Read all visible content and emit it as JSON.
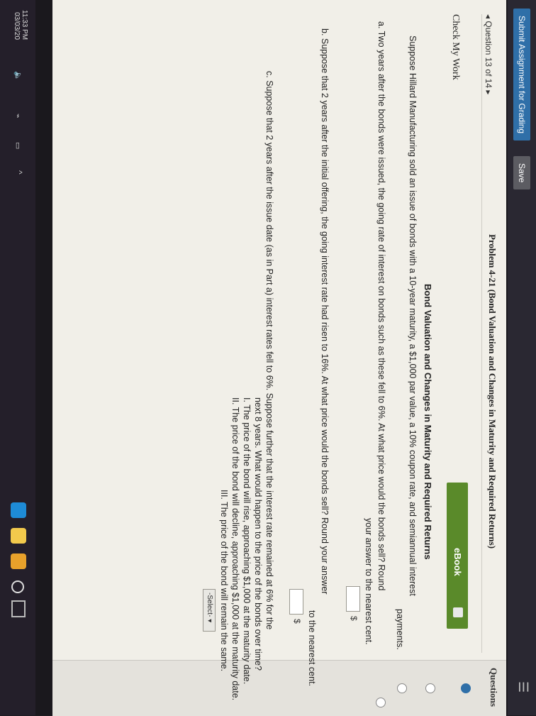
{
  "header": {
    "submit_label": "Submit Assignment for Grading",
    "save_label": "Save"
  },
  "sidebar": {
    "title": "Questions"
  },
  "question_nav": {
    "label": "◂ Question 13 of 14 ▸"
  },
  "problem": {
    "title": "Problem 4-21 (Bond Valuation and Changes in Maturity and Required Returns)",
    "check_label": "Check My Work",
    "ebook_label": "eBook",
    "heading": "Bond Valuation and Changes in Maturity and Required Returns",
    "intro1": "Suppose Hillard Manufacturing sold an issue of bonds with a 10-year maturity, a $1,000 par value, a 10% coupon rate, and semiannual interest",
    "intro2": "payments.",
    "a1": "a. Two years after the bonds were issued, the going rate of interest on bonds such as these fell to 6%. At what price would the bonds sell? Round",
    "a2": "your answer to the nearest cent.",
    "dollar": "$",
    "b1": "b. Suppose that 2 years after the initial offering, the going interest rate had risen to 16%. At what price would the bonds sell? Round your answer",
    "b2": "to the nearest cent.",
    "c1": "c. Suppose that 2 years after the issue date (as in Part a) interest rates fell to 6%. Suppose further that the interest rate remained at 6% for the",
    "c2": "next 8 years. What would happen to the price of the bonds over time?",
    "opt1": "I. The price of the bond will rise, approaching $1,000 at the maturity date.",
    "opt2": "II. The price of the bond will decline, approaching $1,000 at the maturity date.",
    "opt3": "III. The price of the bond will remain the same.",
    "select_label": "-Select-"
  },
  "taskbar": {
    "time": "11:33 PM",
    "date": "03/03/20"
  }
}
